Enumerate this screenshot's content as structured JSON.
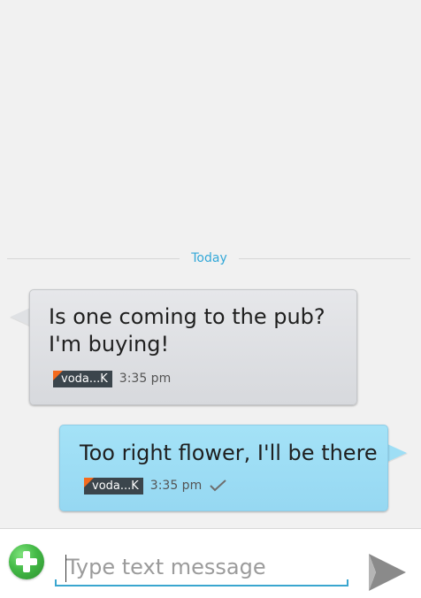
{
  "conversation": {
    "date_label": "Today",
    "messages": [
      {
        "direction": "incoming",
        "text": "Is one coming to the pub?\nI'm buying!",
        "carrier": "voda...K",
        "time": "3:35 pm",
        "delivered": false
      },
      {
        "direction": "outgoing",
        "text": "Too right flower, I'll be there",
        "carrier": "voda...K",
        "time": "3:35 pm",
        "delivered": true
      }
    ]
  },
  "composer": {
    "placeholder": "Type text message",
    "value": "",
    "add_icon": "add-attachment-icon",
    "send_icon": "send-icon"
  },
  "colors": {
    "accent": "#33a8d8",
    "incoming_bubble": "#dfe1e4",
    "outgoing_bubble": "#9edef5",
    "carrier_badge": "#3b454c",
    "carrier_corner": "#f46a1c",
    "add_button": "#43b946"
  }
}
